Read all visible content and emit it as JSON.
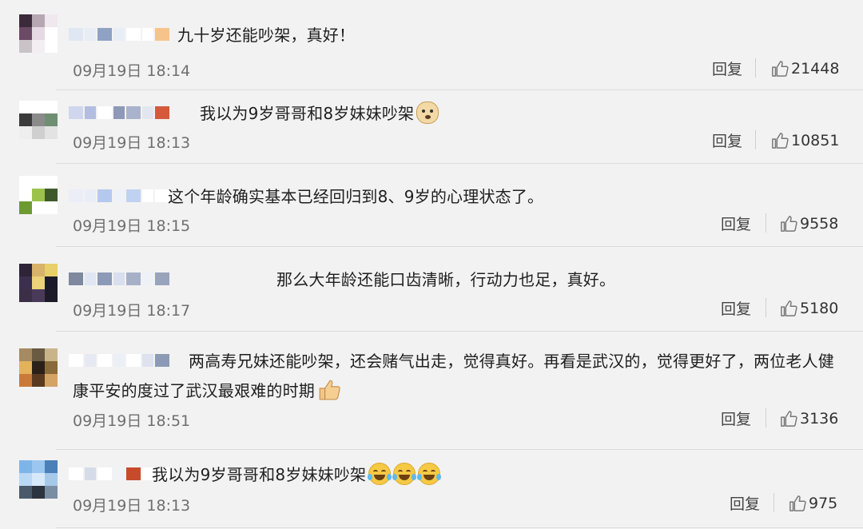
{
  "ui": {
    "reply_label": "回复"
  },
  "comments": [
    {
      "text": "九十岁还能吵架，真好！",
      "time": "09月19日 18:14",
      "likes": "21448",
      "avatar": [
        "#3a2a3a",
        "#b7a7b3",
        "#efe8ee",
        "#6b4a66",
        "#e6d9e3",
        "#ffffff",
        "#c9c2c7",
        "#f3eef1",
        "#ffffff"
      ],
      "nick": [
        "#dfe7f2",
        "#e8ecf4",
        "#8fa2c4",
        "#e9edf5",
        "#ffffff",
        "#ffffff",
        "#f7c38a"
      ]
    },
    {
      "text": "我以为9岁哥哥和8岁妹妹吵架",
      "emoji": "doge",
      "time": "09月19日 18:13",
      "likes": "10851",
      "avatar": [
        "#ffffff",
        "#ffffff",
        "#ffffff",
        "#3b3b3b",
        "#8b8b8b",
        "#6f8f73",
        "#eeeeee",
        "#cfcfcf",
        "#e3e3e3"
      ],
      "nick": [
        "#cfd6ee",
        "#b3bde0",
        "#ffffff",
        "#8e98b8",
        "#aab3cc",
        "#e3e6ef",
        "#d45a3a"
      ]
    },
    {
      "text": "这个年龄确实基本已经回归到8、9岁的心理状态了。",
      "time": "09月19日 18:15",
      "likes": "9558",
      "avatar": [
        "#ffffff",
        "#ffffff",
        "#ffffff",
        "#ffffff",
        "#9cc24a",
        "#3e5a2a",
        "#6e9a32",
        "#ffffff",
        "#ffffff"
      ],
      "nick": [
        "#ebeef7",
        "#e8edf7",
        "#b5c8ee",
        "#eef1f7",
        "#c0d2f2",
        "#ffffff",
        "#ffffff"
      ]
    },
    {
      "text": "那么大年龄还能口齿清晰，行动力也足，真好。",
      "time": "09月19日 18:17",
      "likes": "5180",
      "avatar": [
        "#2d2438",
        "#d8b26a",
        "#e8cf6a",
        "#3a2f4f",
        "#ecd27a",
        "#1c1a2a",
        "#3b2f48",
        "#4a3a5a",
        "#1d1b28"
      ],
      "nick": [
        "#7e889e",
        "#e0e6f2",
        "#8c9ab8",
        "#d9dfee",
        "#a6b1c8",
        "#eef1f6",
        "#98a3bc"
      ]
    },
    {
      "text": "两高寿兄妹还能吵架，还会赌气出走，觉得真好。再看是武汉的，觉得更好了，两位老人健",
      "text2": "康平安的度过了武汉最艰难的时期",
      "emoji": "thumb",
      "time": "09月19日 18:51",
      "likes": "3136",
      "avatar": [
        "#a58a62",
        "#6a5a42",
        "#c9b48a",
        "#e3b25a",
        "#2a2018",
        "#8a6a3a",
        "#c97a3a",
        "#5a3a1e",
        "#d4a466"
      ],
      "nick": [
        "#ffffff",
        "#e6e9f1",
        "#ffffff",
        "#eceff5",
        "#ffffff",
        "#dde2ee",
        "#8c9ab5"
      ]
    },
    {
      "text": "我以为9岁哥哥和8岁妹妹吵架",
      "emoji": "laugh3",
      "time": "09月19日 18:13",
      "likes": "975",
      "avatar": [
        "#7fb4e8",
        "#9ac6f0",
        "#4b7fb8",
        "#b9d8f5",
        "#d7e9f8",
        "#a6c9ea",
        "#4a5a6a",
        "#2c3440",
        "#7a8ea3"
      ],
      "nick": [
        "#ffffff",
        "#d5dbe7",
        "#ffffff",
        "#f0f2f6",
        "#c84a2a",
        "#ffffff",
        "#ffffff"
      ]
    }
  ]
}
